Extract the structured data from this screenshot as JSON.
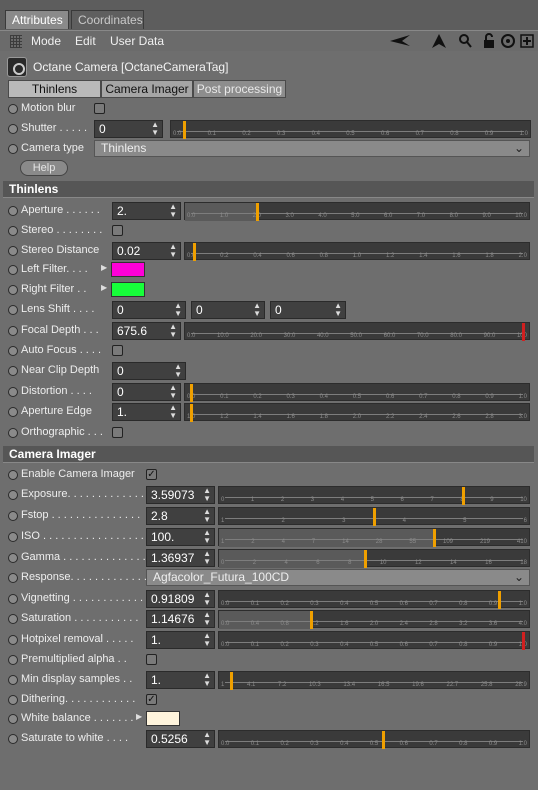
{
  "tabs": {
    "attributes": "Attributes",
    "coordinates": "Coordinates"
  },
  "menu": {
    "mode": "Mode",
    "edit": "Edit",
    "user_data": "User Data"
  },
  "toolbar_icons": [
    "arrow-left-icon",
    "arrow-up-icon",
    "search-icon",
    "lock-icon",
    "target-icon",
    "add-icon"
  ],
  "object_title": "Octane Camera [OctaneCameraTag]",
  "subtabs": {
    "thinlens": "Thinlens",
    "camera_imager": "Camera Imager",
    "post_processing": "Post processing"
  },
  "top": {
    "motion_blur": "Motion blur",
    "shutter_label": "Shutter . . . . .",
    "shutter_value": "0",
    "camera_type_label": "Camera type",
    "camera_type_value": "Thinlens",
    "help": "Help"
  },
  "thinlens": {
    "title": "Thinlens",
    "aperture_label": "Aperture . . . . . .",
    "aperture_value": "2.",
    "stereo_label": "Stereo . . . . . . . .",
    "stereo_distance_label": "Stereo Distance",
    "stereo_distance_value": "0.02",
    "left_filter_label": "Left Filter. . . .",
    "left_filter_color": "#ff00d8",
    "right_filter_label": "Right Filter . .",
    "right_filter_color": "#17ff3a",
    "lens_shift_label": "Lens Shift . . . .",
    "lens_shift_values": [
      "0",
      "0",
      "0"
    ],
    "focal_depth_label": "Focal Depth . . .",
    "focal_depth_value": "675.6",
    "auto_focus_label": "Auto Focus . . . .",
    "near_clip_label": "Near Clip Depth",
    "near_clip_value": "0",
    "distortion_label": "Distortion . . . .",
    "distortion_value": "0",
    "aperture_edge_label": "Aperture Edge",
    "aperture_edge_value": "1.",
    "orthographic_label": "Orthographic . . ."
  },
  "imager": {
    "title": "Camera Imager",
    "enable_label": "Enable Camera Imager",
    "exposure_label": "Exposure. . . . . . . . . . . . .",
    "exposure_value": "3.59073",
    "fstop_label": "Fstop . . . . . . . . . . . . . . .",
    "fstop_value": "2.8",
    "iso_label": "ISO . . . . . . . . . . . . . . . . .",
    "iso_value": "100.",
    "gamma_label": "Gamma . . . . . . . . . . . . . .",
    "gamma_value": "1.36937",
    "response_label": "Response. . . . . . . . . . . . .",
    "response_value": "Agfacolor_Futura_100CD",
    "vignetting_label": "Vignetting . . . . . . . . . . . .",
    "vignetting_value": "0.91809",
    "saturation_label": "Saturation . . . . . . . . . . .",
    "saturation_value": "1.14676",
    "hotpixel_label": "Hotpixel removal . . . . .",
    "hotpixel_value": "1.",
    "premultiplied_label": "Premultiplied alpha . .",
    "min_samples_label": "Min display samples . .",
    "min_samples_value": "1.",
    "dithering_label": "Dithering. . . . . . . . . . . .",
    "white_balance_label": "White balance . . . . . . .",
    "white_balance_color": "#fff4dc",
    "saturate_white_label": "Saturate to white . . . .",
    "saturate_white_value": "0.5256"
  },
  "ticks": {
    "shutter": [
      "0.0",
      "0.1",
      "0.2",
      "0.3",
      "0.4",
      "0.5",
      "0.6",
      "0.7",
      "0.8",
      "0.9",
      "1.0"
    ],
    "aperture": [
      "0.0",
      "1.0",
      "2.0",
      "3.0",
      "4.0",
      "5.0",
      "6.0",
      "7.0",
      "8.0",
      "9.0",
      "10.0"
    ],
    "stereo": [
      "0.0",
      "0.2",
      "0.4",
      "0.6",
      "0.8",
      "1.0",
      "1.2",
      "1.4",
      "1.6",
      "1.8",
      "2.0"
    ],
    "focal": [
      "0.0",
      "10.0",
      "20.0",
      "30.0",
      "40.0",
      "50.0",
      "60.0",
      "70.0",
      "80.0",
      "90.0",
      "100"
    ],
    "unit": [
      "0.0",
      "0.1",
      "0.2",
      "0.3",
      "0.4",
      "0.5",
      "0.6",
      "0.7",
      "0.8",
      "0.9",
      "1.0"
    ],
    "edge": [
      "1.0",
      "1.2",
      "1.4",
      "1.6",
      "1.8",
      "2.0",
      "2.2",
      "2.4",
      "2.6",
      "2.8",
      "3.0"
    ],
    "exposure": [
      "0",
      "1",
      "2",
      "3",
      "4",
      "5",
      "6",
      "7",
      "8",
      "9",
      "10"
    ],
    "fstop": [
      "1",
      "2",
      "3",
      "4",
      "5",
      "6"
    ],
    "iso": [
      "1",
      "2",
      "4",
      "7",
      "14",
      "28",
      "55",
      "109",
      "219",
      "410"
    ],
    "gamma": [
      "0",
      "2",
      "4",
      "6",
      "8",
      "10",
      "12",
      "14",
      "16",
      "18"
    ],
    "saturation": [
      "0.0",
      "0.4",
      "0.8",
      "1.2",
      "1.6",
      "2.0",
      "2.4",
      "2.8",
      "3.2",
      "3.6",
      "4.0"
    ],
    "samples": [
      "1",
      "4.1",
      "7.2",
      "10.3",
      "13.4",
      "16.5",
      "19.6",
      "22.7",
      "25.8",
      "28.9"
    ]
  }
}
